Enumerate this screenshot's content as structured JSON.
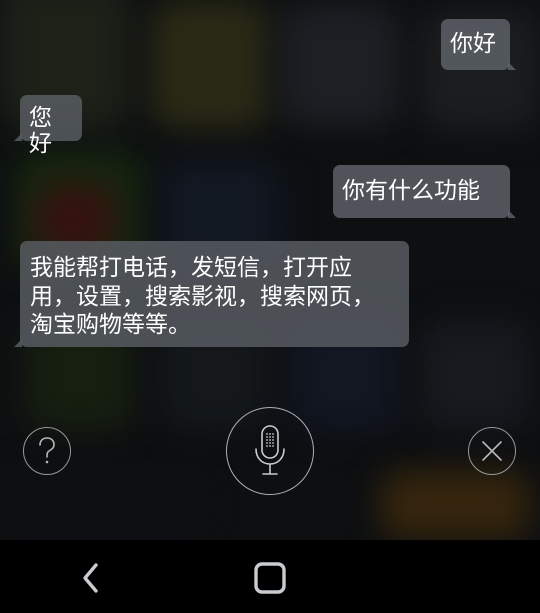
{
  "conversation": {
    "messages": [
      {
        "sender": "user",
        "text": "你好"
      },
      {
        "sender": "assistant",
        "text": "您好"
      },
      {
        "sender": "user",
        "text": "你有什么功能"
      },
      {
        "sender": "assistant",
        "text": "我能帮打电话，发短信，打开应用，设置，搜索影视，搜索网页，淘宝购物等等。"
      }
    ]
  },
  "controls": {
    "help_icon": "question-mark-icon",
    "mic_icon": "microphone-icon",
    "close_icon": "close-x-icon"
  },
  "navbar": {
    "back_icon": "back-chevron-icon",
    "home_icon": "home-square-icon"
  },
  "colors": {
    "bubble": "#5f646a",
    "icon_stroke": "#b4b9be",
    "navbar": "#000000"
  }
}
